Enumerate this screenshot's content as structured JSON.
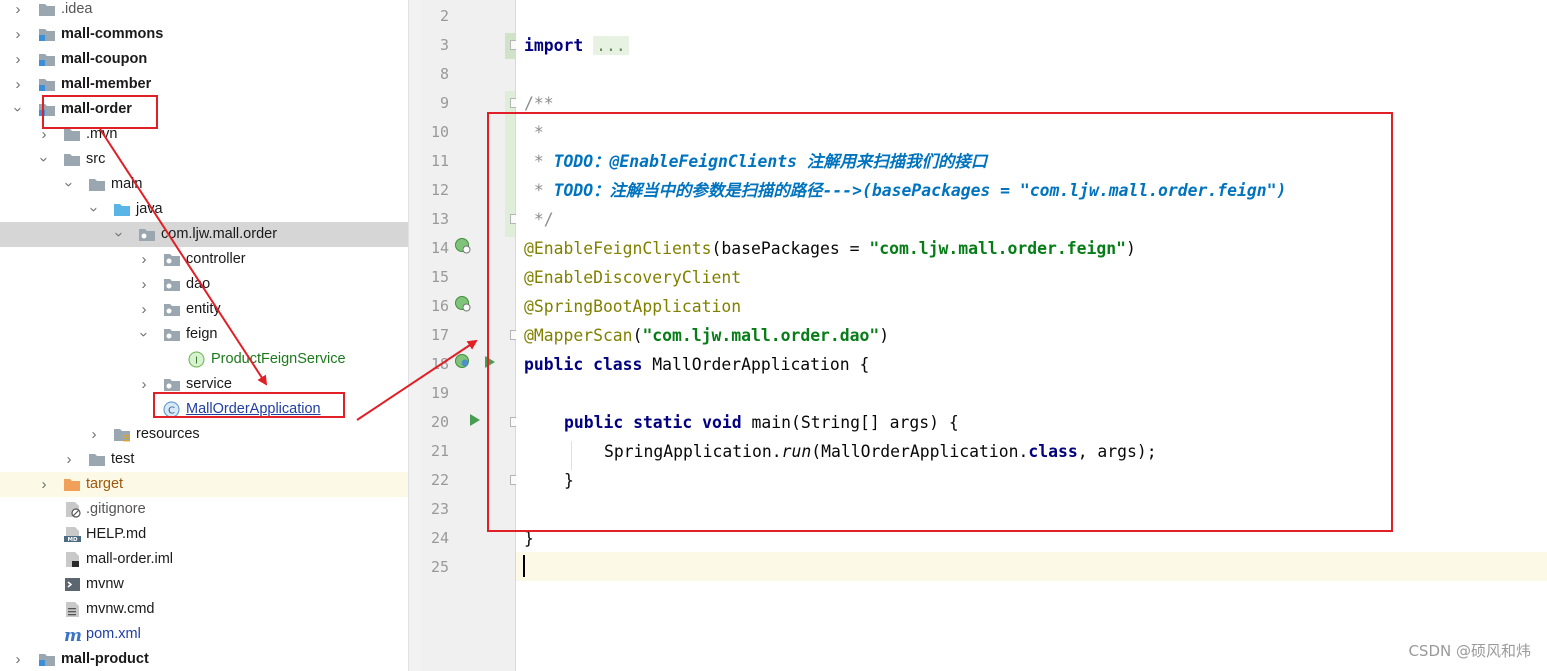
{
  "tree": {
    "items": [
      {
        "label": ".idea",
        "expanded": false,
        "icon": "folder-icon"
      },
      {
        "label": "mall-commons",
        "expanded": false,
        "icon": "module-folder-icon"
      },
      {
        "label": "mall-coupon",
        "expanded": false,
        "icon": "module-folder-icon"
      },
      {
        "label": "mall-member",
        "expanded": false,
        "icon": "module-folder-icon"
      },
      {
        "label": "mall-order",
        "expanded": true,
        "icon": "module-folder-icon"
      },
      {
        "label": ".mvn",
        "expanded": false,
        "icon": "folder-icon"
      },
      {
        "label": "src",
        "expanded": true,
        "icon": "folder-icon"
      },
      {
        "label": "main",
        "expanded": true,
        "icon": "folder-icon"
      },
      {
        "label": "java",
        "expanded": true,
        "icon": "source-folder-icon"
      },
      {
        "label": "com.ljw.mall.order",
        "expanded": true,
        "icon": "package-icon",
        "selected": true
      },
      {
        "label": "controller",
        "expanded": false,
        "icon": "package-icon"
      },
      {
        "label": "dao",
        "expanded": false,
        "icon": "package-icon"
      },
      {
        "label": "entity",
        "expanded": false,
        "icon": "package-icon"
      },
      {
        "label": "feign",
        "expanded": true,
        "icon": "package-icon"
      },
      {
        "label": "ProductFeignService",
        "icon": "interface-icon"
      },
      {
        "label": "service",
        "expanded": false,
        "icon": "package-icon"
      },
      {
        "label": "MallOrderApplication",
        "icon": "spring-class-icon"
      },
      {
        "label": "resources",
        "expanded": false,
        "icon": "resources-folder-icon"
      },
      {
        "label": "test",
        "expanded": false,
        "icon": "folder-icon"
      },
      {
        "label": "target",
        "expanded": false,
        "icon": "excluded-folder-icon"
      },
      {
        "label": ".gitignore",
        "icon": "gitignore-file-icon"
      },
      {
        "label": "HELP.md",
        "icon": "markdown-file-icon"
      },
      {
        "label": "mall-order.iml",
        "icon": "iml-file-icon"
      },
      {
        "label": "mvnw",
        "icon": "shell-file-icon"
      },
      {
        "label": "mvnw.cmd",
        "icon": "text-file-icon"
      },
      {
        "label": "pom.xml",
        "icon": "maven-file-icon"
      },
      {
        "label": "mall-product",
        "expanded": false,
        "icon": "module-folder-icon"
      }
    ]
  },
  "gutter": {
    "line_numbers": [
      "2",
      "3",
      "8",
      "9",
      "10",
      "11",
      "12",
      "13",
      "14",
      "15",
      "16",
      "17",
      "18",
      "19",
      "20",
      "21",
      "22",
      "23",
      "24",
      "25"
    ]
  },
  "code": {
    "import_kw": "import",
    "import_fold": "...",
    "c_open": "/**",
    "c_star": " *",
    "c1_star": " * ",
    "c1_todo": "TODO：@EnableFeignClients 注解用来扫描我们的接口",
    "c2_star": " * ",
    "c2_todo": "TODO：注解当中的参数是扫描的路径--->(basePackages = \"com.ljw.mall.order.feign\")",
    "c_close": " */",
    "ann1": "@EnableFeignClients",
    "ann1_mid": "(basePackages = ",
    "ann1_str": "\"com.ljw.mall.order.feign\"",
    "ann1_end": ")",
    "ann2": "@EnableDiscoveryClient",
    "ann3": "@SpringBootApplication",
    "ann4": "@MapperScan",
    "ann4_open": "(",
    "ann4_str": "\"com.ljw.mall.order.dao\"",
    "ann4_end": ")",
    "cls_kw": "public class",
    "cls_name": " MallOrderApplication {",
    "main_kw": "public static void",
    "main_sig": " main(String[] args) {",
    "run_pre": "SpringApplication.",
    "run_m": "run",
    "run_mid": "(MallOrderApplication.",
    "run_kw": "class",
    "run_end": ", args);",
    "close_method": "}",
    "close_class": "}"
  },
  "watermark": "CSDN @硕风和炜",
  "colors": {
    "annotation_red": "#e01f26",
    "keyword": "#000080",
    "annotation": "#808000",
    "string": "#067d17",
    "todo": "#0073bf",
    "selection": "#d6d6d6",
    "caret_line": "#fcfae6"
  }
}
